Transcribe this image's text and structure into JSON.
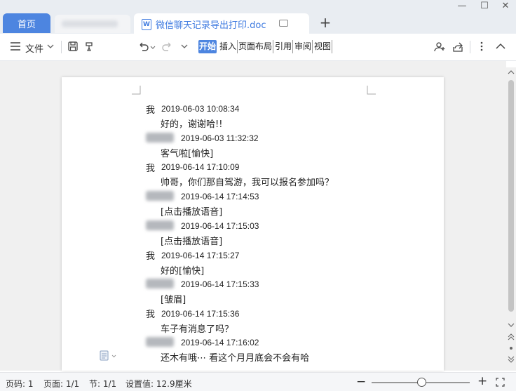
{
  "tabs": {
    "home": "首页",
    "doc_icon": "W",
    "doc_title": "微信聊天记录导出打印.doc",
    "add": "+"
  },
  "window": {
    "restore": "☐",
    "close": "✕",
    "minimize": "—"
  },
  "toolbar": {
    "file_menu": "文件",
    "ribbon": [
      "开始",
      "插入",
      "页面布局",
      "引用",
      "审阅",
      "视图"
    ]
  },
  "messages": [
    {
      "sender": "我",
      "time": "2019-06-03 10:08:34",
      "text": "好的，谢谢哈!!"
    },
    {
      "sender": "",
      "time": "2019-06-03 11:32:32",
      "text": "客气啦[愉快]"
    },
    {
      "sender": "我",
      "time": "2019-06-14 17:10:09",
      "text": "帅哥，你们那自驾游，我可以报名参加吗？"
    },
    {
      "sender": "",
      "time": "2019-06-14 17:14:53",
      "text": "[点击播放语音]"
    },
    {
      "sender": "",
      "time": "2019-06-14 17:15:03",
      "text": "[点击播放语音]"
    },
    {
      "sender": "我",
      "time": "2019-06-14 17:15:27",
      "text": "好的[愉快]"
    },
    {
      "sender": "",
      "time": "2019-06-14 17:15:33",
      "text": "[皱眉]"
    },
    {
      "sender": "我",
      "time": "2019-06-14 17:15:36",
      "text": "车子有消息了吗？"
    },
    {
      "sender": "",
      "time": "2019-06-14 17:16:02",
      "text": "还木有哦⋯ 看这个月月底会不会有哈"
    }
  ],
  "status": {
    "page_no": "页码: 1",
    "pages": "页面: 1/1",
    "section": "节: 1/1",
    "setting": "设置值: 12.9厘米"
  },
  "zoom": {
    "minus": "−",
    "plus": "+"
  },
  "colors": {
    "accent": "#4d85e0",
    "doc_title": "#3f7be0"
  }
}
